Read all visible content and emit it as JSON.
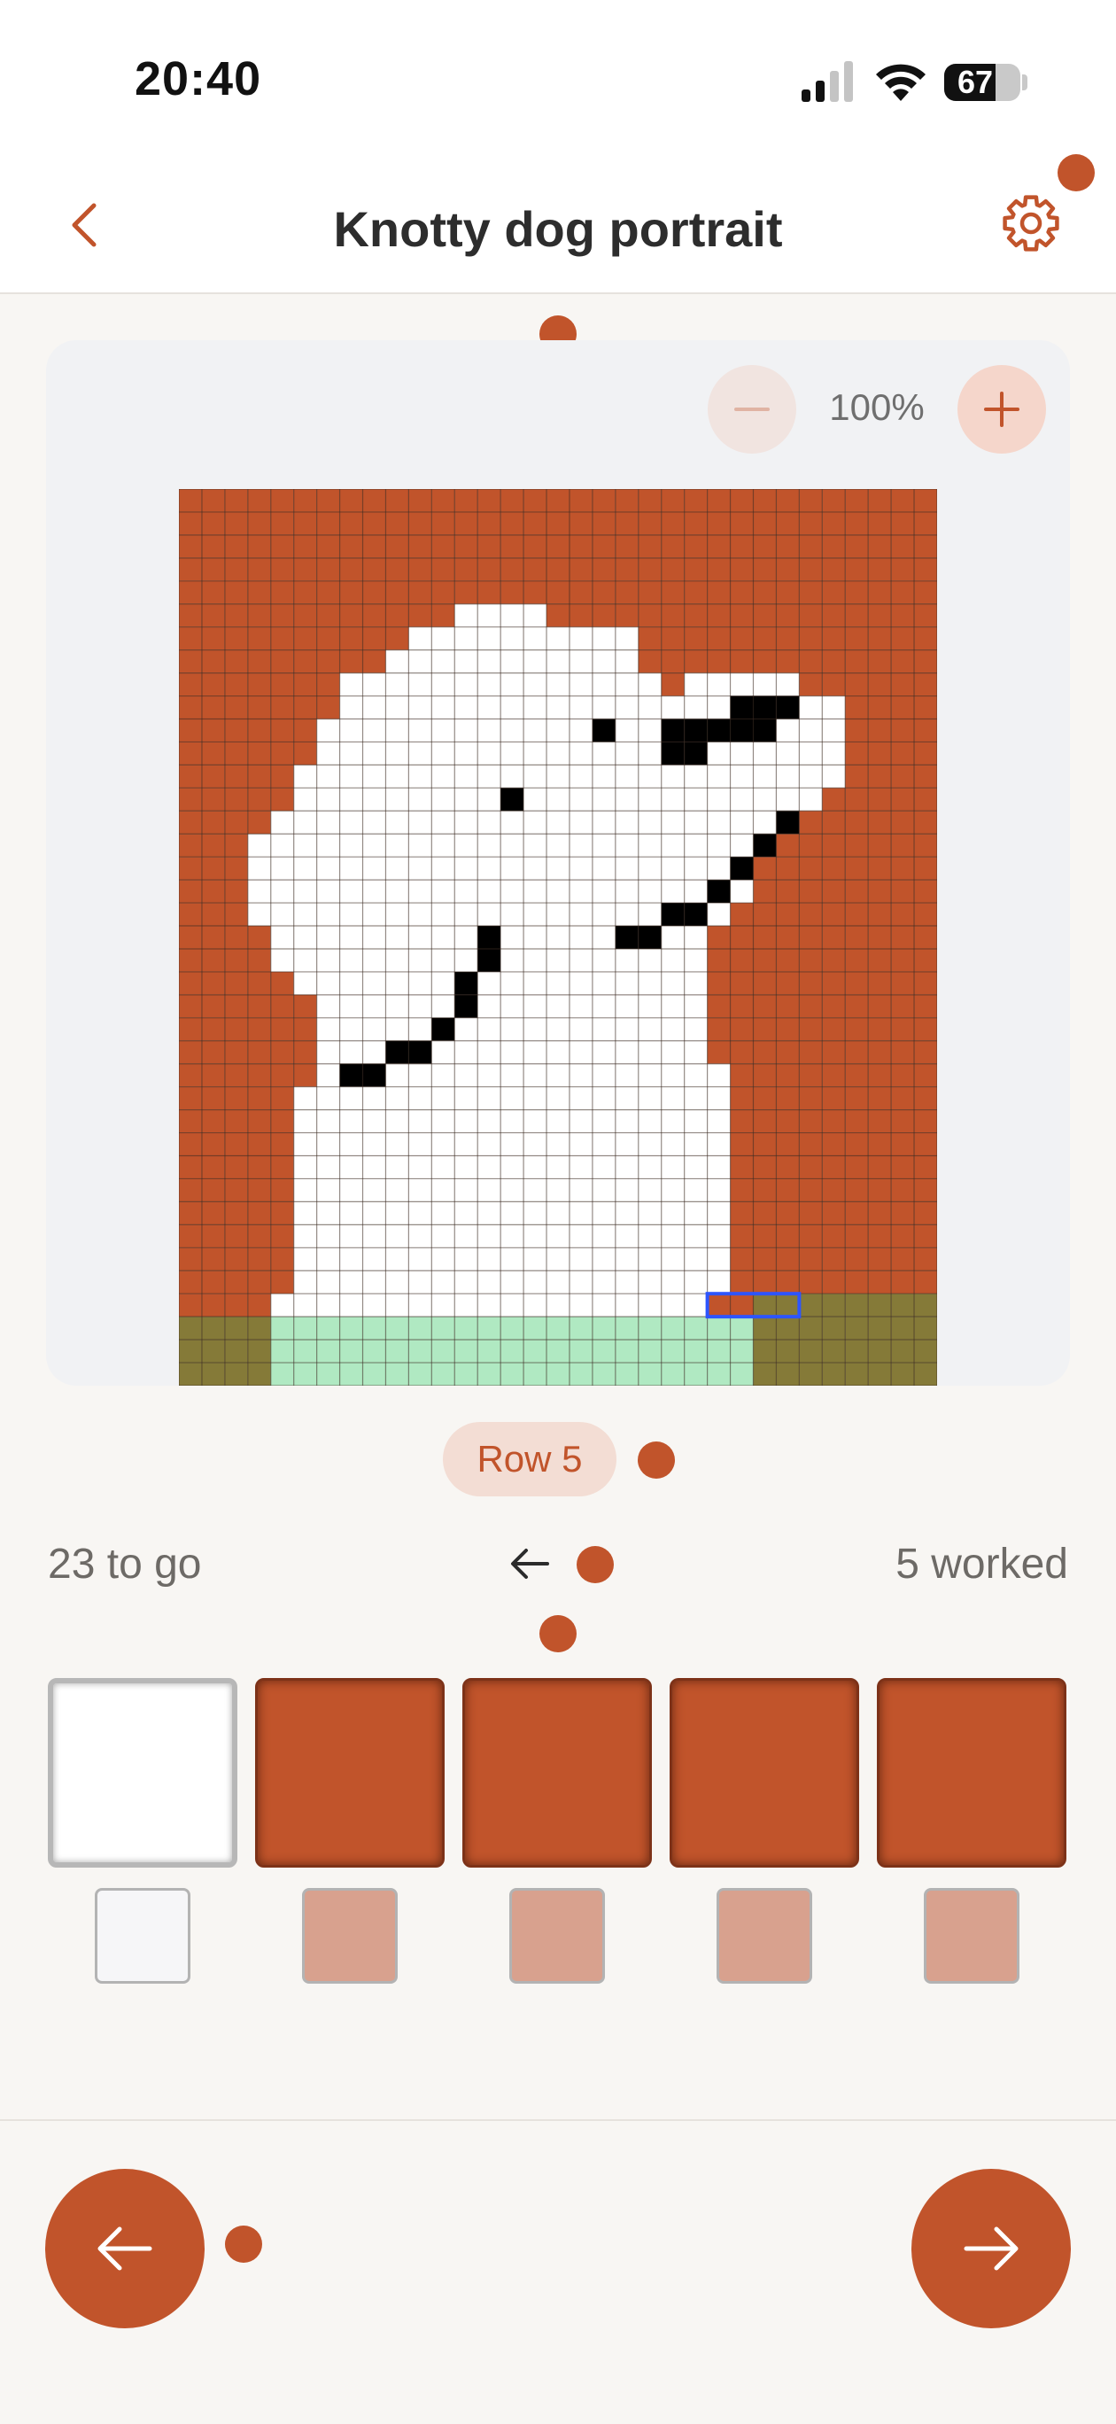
{
  "status_bar": {
    "time": "20:40",
    "battery_level": "67",
    "battery_fraction": 0.67
  },
  "header": {
    "title": "Knotty dog portrait",
    "back_icon": "chevron-left-icon",
    "settings_icon": "gear-icon"
  },
  "zoom": {
    "level_label": "100%",
    "minus_icon": "minus-icon",
    "plus_icon": "plus-icon"
  },
  "pattern": {
    "columns": 33,
    "rows": 39,
    "colors": {
      "rust": "#c1542b",
      "white": "#ffffff",
      "black": "#000000",
      "mint": "#b0e9c2",
      "olive": "#857a38",
      "grid_line": "#3a2a20",
      "highlight": "#2d55ff"
    },
    "highlight_cells": {
      "row": 35,
      "col_start": 23,
      "col_end": 27
    }
  },
  "progress": {
    "row_label": "Row 5",
    "remaining_label": "23 to go",
    "worked_label": "5 worked",
    "direction_icon": "arrow-left-icon"
  },
  "stitches": [
    {
      "color": "white",
      "hex": "#ffffff"
    },
    {
      "color": "rust",
      "hex": "#c1542b"
    },
    {
      "color": "rust",
      "hex": "#c1542b"
    },
    {
      "color": "rust",
      "hex": "#c1542b"
    },
    {
      "color": "rust",
      "hex": "#c1542b"
    }
  ],
  "navigation": {
    "prev_icon": "arrow-left-icon",
    "next_icon": "arrow-right-icon"
  },
  "accent_color": "#c1542b"
}
